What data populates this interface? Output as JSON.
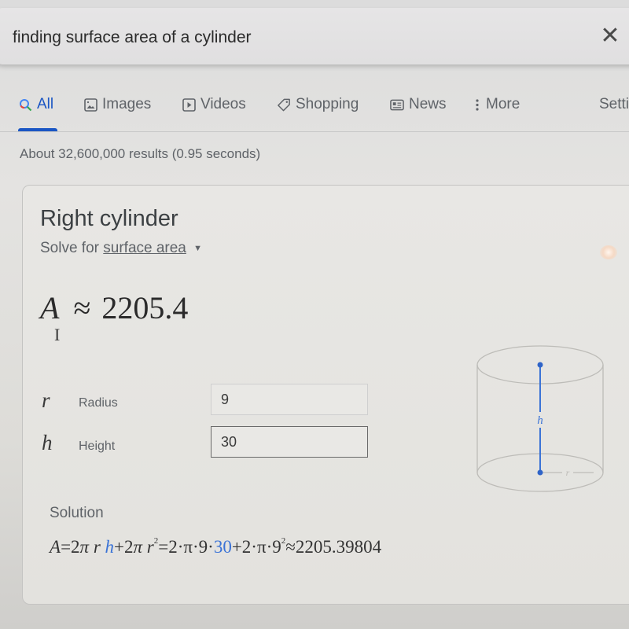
{
  "search": {
    "query": "finding surface area of a cylinder",
    "clear_icon": "close-icon"
  },
  "tabs": [
    {
      "label": "All",
      "icon": "search-icon",
      "active": true
    },
    {
      "label": "Images",
      "icon": "image-icon",
      "active": false
    },
    {
      "label": "Videos",
      "icon": "play-icon",
      "active": false
    },
    {
      "label": "Shopping",
      "icon": "tag-icon",
      "active": false
    },
    {
      "label": "News",
      "icon": "newspaper-icon",
      "active": false
    },
    {
      "label": "More",
      "icon": "more-vert-icon",
      "active": false
    },
    {
      "label": "Setti",
      "icon": null,
      "active": false
    }
  ],
  "result_stats": "About 32,600,000 results (0.95 seconds)",
  "calculator": {
    "title": "Right cylinder",
    "solve_for_prefix": "Solve for",
    "solve_for_value": "surface area",
    "result_symbol": "A",
    "result_approx": "≈",
    "result_value": "2205.4",
    "cursor_glyph": "I",
    "variables": [
      {
        "symbol": "r",
        "label": "Radius",
        "value": "9"
      },
      {
        "symbol": "h",
        "label": "Height",
        "value": "30"
      }
    ],
    "diagram": {
      "height_label": "h",
      "radius_label": "r",
      "accent_color": "#3b73d6"
    },
    "solution_label": "Solution",
    "solution": {
      "lhs": "A",
      "eq1": "=",
      "f1": "2",
      "pi": "π",
      "r": "r",
      "h": "h",
      "plus": "+",
      "f2": "2",
      "r2": "r",
      "sq": "2",
      "eq2": "=",
      "sub1": "2·π·9·",
      "sub_h": "30",
      "sub2": "+2·π·9",
      "sq2": "2",
      "approx": "≈",
      "value": "2205.39804"
    }
  }
}
